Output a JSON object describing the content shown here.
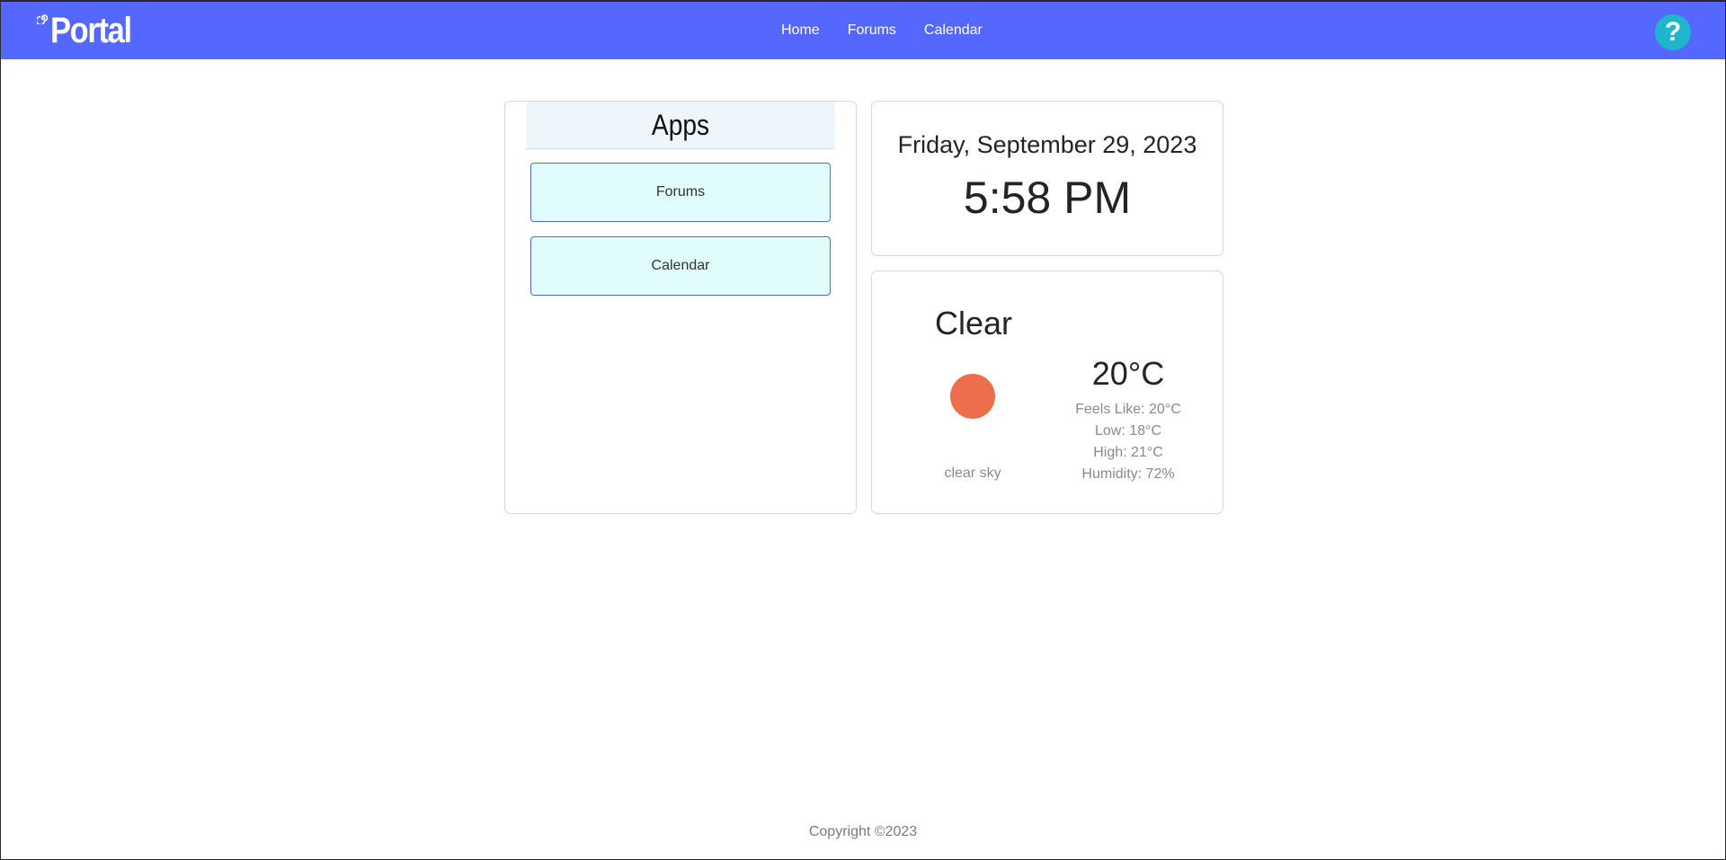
{
  "header": {
    "brand": "Portal",
    "brand_icon": "swirl-logo-icon",
    "nav": [
      "Home",
      "Forums",
      "Calendar"
    ],
    "help_label": "?",
    "help_icon": "question-mark-icon",
    "bg_color": "#5468ff",
    "help_color": "#1eb6cc"
  },
  "apps": {
    "title": "Apps",
    "items": [
      "Forums",
      "Calendar"
    ]
  },
  "datetime": {
    "date": "Friday, September 29, 2023",
    "time": "5:58 PM"
  },
  "weather": {
    "main": "Clear",
    "icon": "sun-icon",
    "icon_color": "#ec6e4c",
    "description": "clear sky",
    "temp": "20°C",
    "feels_like": "Feels Like: 20°C",
    "low": "Low: 18°C",
    "high": "High: 21°C",
    "humidity": "Humidity: 72%"
  },
  "footer": {
    "copyright": "Copyright ©2023"
  }
}
